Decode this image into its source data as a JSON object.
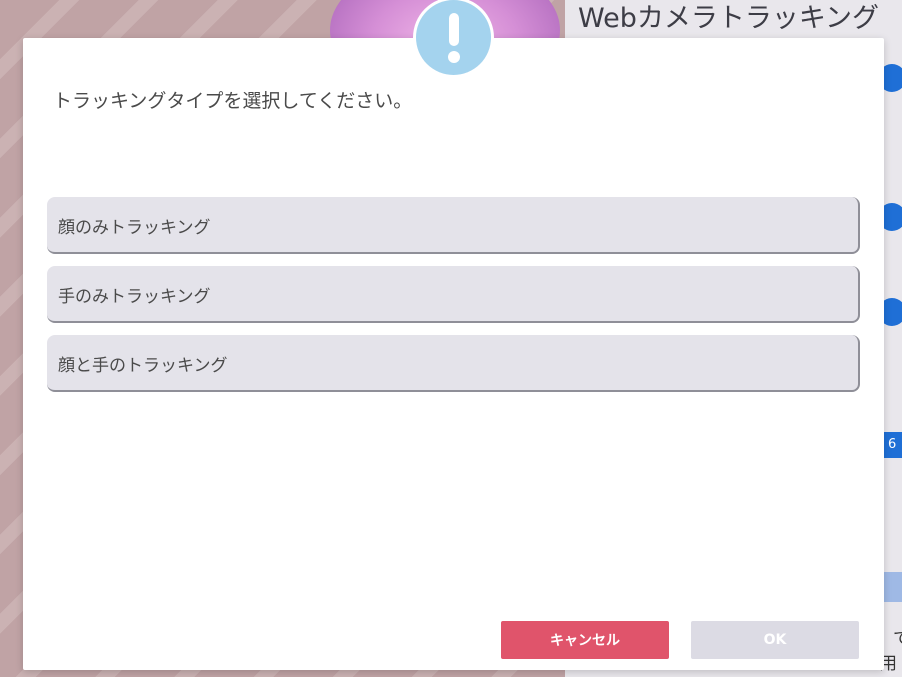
{
  "background": {
    "title": "Webカメラトラッキング",
    "number_badge": "6",
    "fragments": [
      "、て",
      "用"
    ]
  },
  "dialog": {
    "prompt": "トラッキングタイプを選択してください。",
    "options": [
      {
        "label": "顔のみトラッキング"
      },
      {
        "label": "手のみトラッキング"
      },
      {
        "label": "顔と手のトラッキング"
      }
    ],
    "cancel_label": "キャンセル",
    "ok_label": "OK",
    "icon": "exclamation-icon"
  },
  "colors": {
    "accent_cancel": "#e0546b",
    "option_bg": "#e4e3ea",
    "badge": "#a4d3ee",
    "bullet": "#1f6fd6"
  }
}
